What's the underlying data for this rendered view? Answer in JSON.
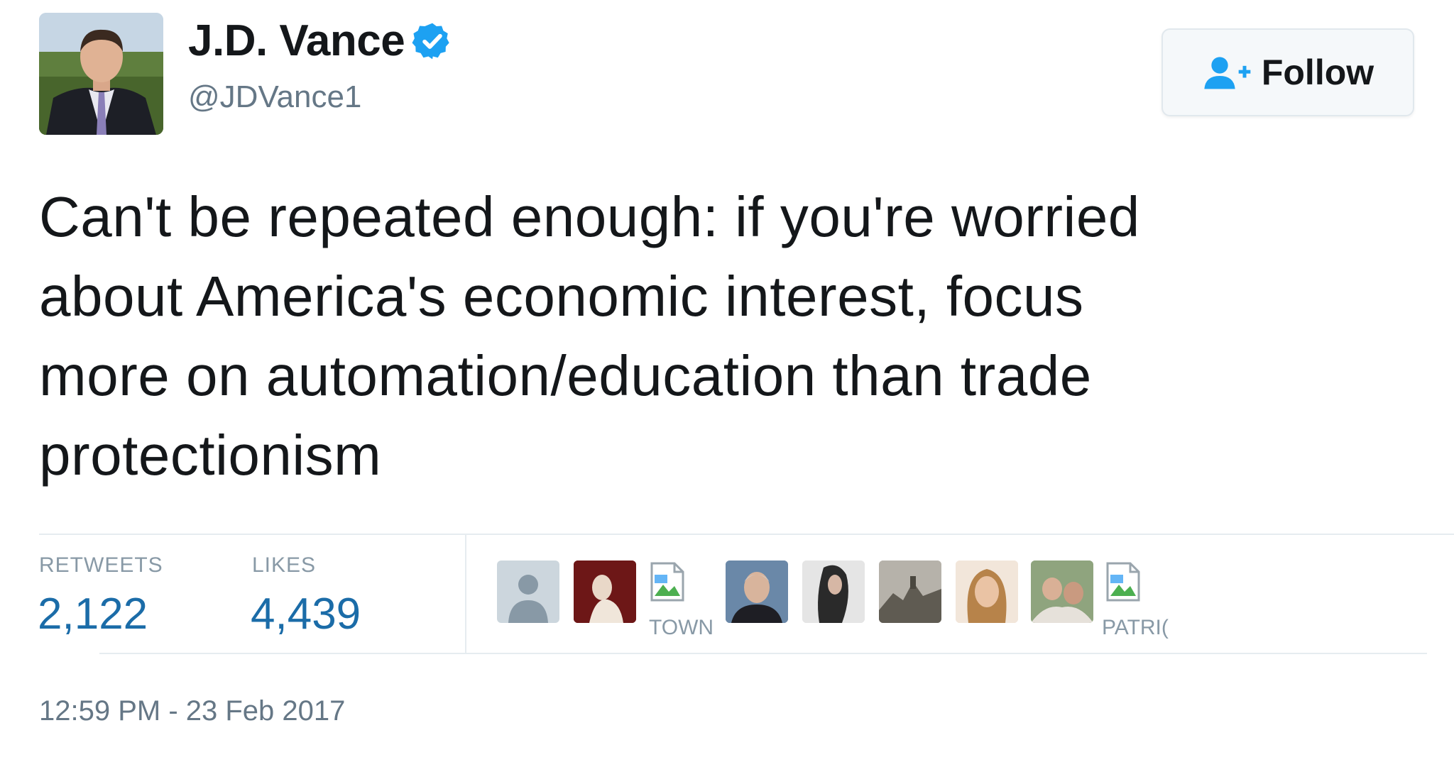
{
  "user": {
    "display_name": "J.D. Vance",
    "handle": "@JDVance1",
    "avatar_icon": "profile-photo",
    "verified_icon": "verified-badge-icon",
    "verified_color": "#1da1f2"
  },
  "follow_button": {
    "label": "Follow",
    "icon": "follow-user-icon",
    "icon_color": "#1da1f2"
  },
  "tweet": {
    "lines": [
      "Can't be repeated enough: if you're worried",
      "about America's economic interest, focus",
      "more on automation/education than trade",
      "protectionism"
    ]
  },
  "stats": {
    "retweets_label": "RETWEETS",
    "retweets_value": "2,122",
    "likes_label": "LIKES",
    "likes_value": "4,439",
    "value_color": "#1b6ca8"
  },
  "likers": [
    {
      "kind": "default-avatar",
      "caption": ""
    },
    {
      "kind": "photo",
      "caption": ""
    },
    {
      "kind": "broken-image",
      "caption": "TOWN"
    },
    {
      "kind": "photo",
      "caption": ""
    },
    {
      "kind": "photo",
      "caption": ""
    },
    {
      "kind": "photo",
      "caption": ""
    },
    {
      "kind": "photo",
      "caption": ""
    },
    {
      "kind": "photo",
      "caption": ""
    },
    {
      "kind": "broken-image",
      "caption": "PATRI("
    }
  ],
  "timestamp": "12:59 PM - 23 Feb 2017"
}
